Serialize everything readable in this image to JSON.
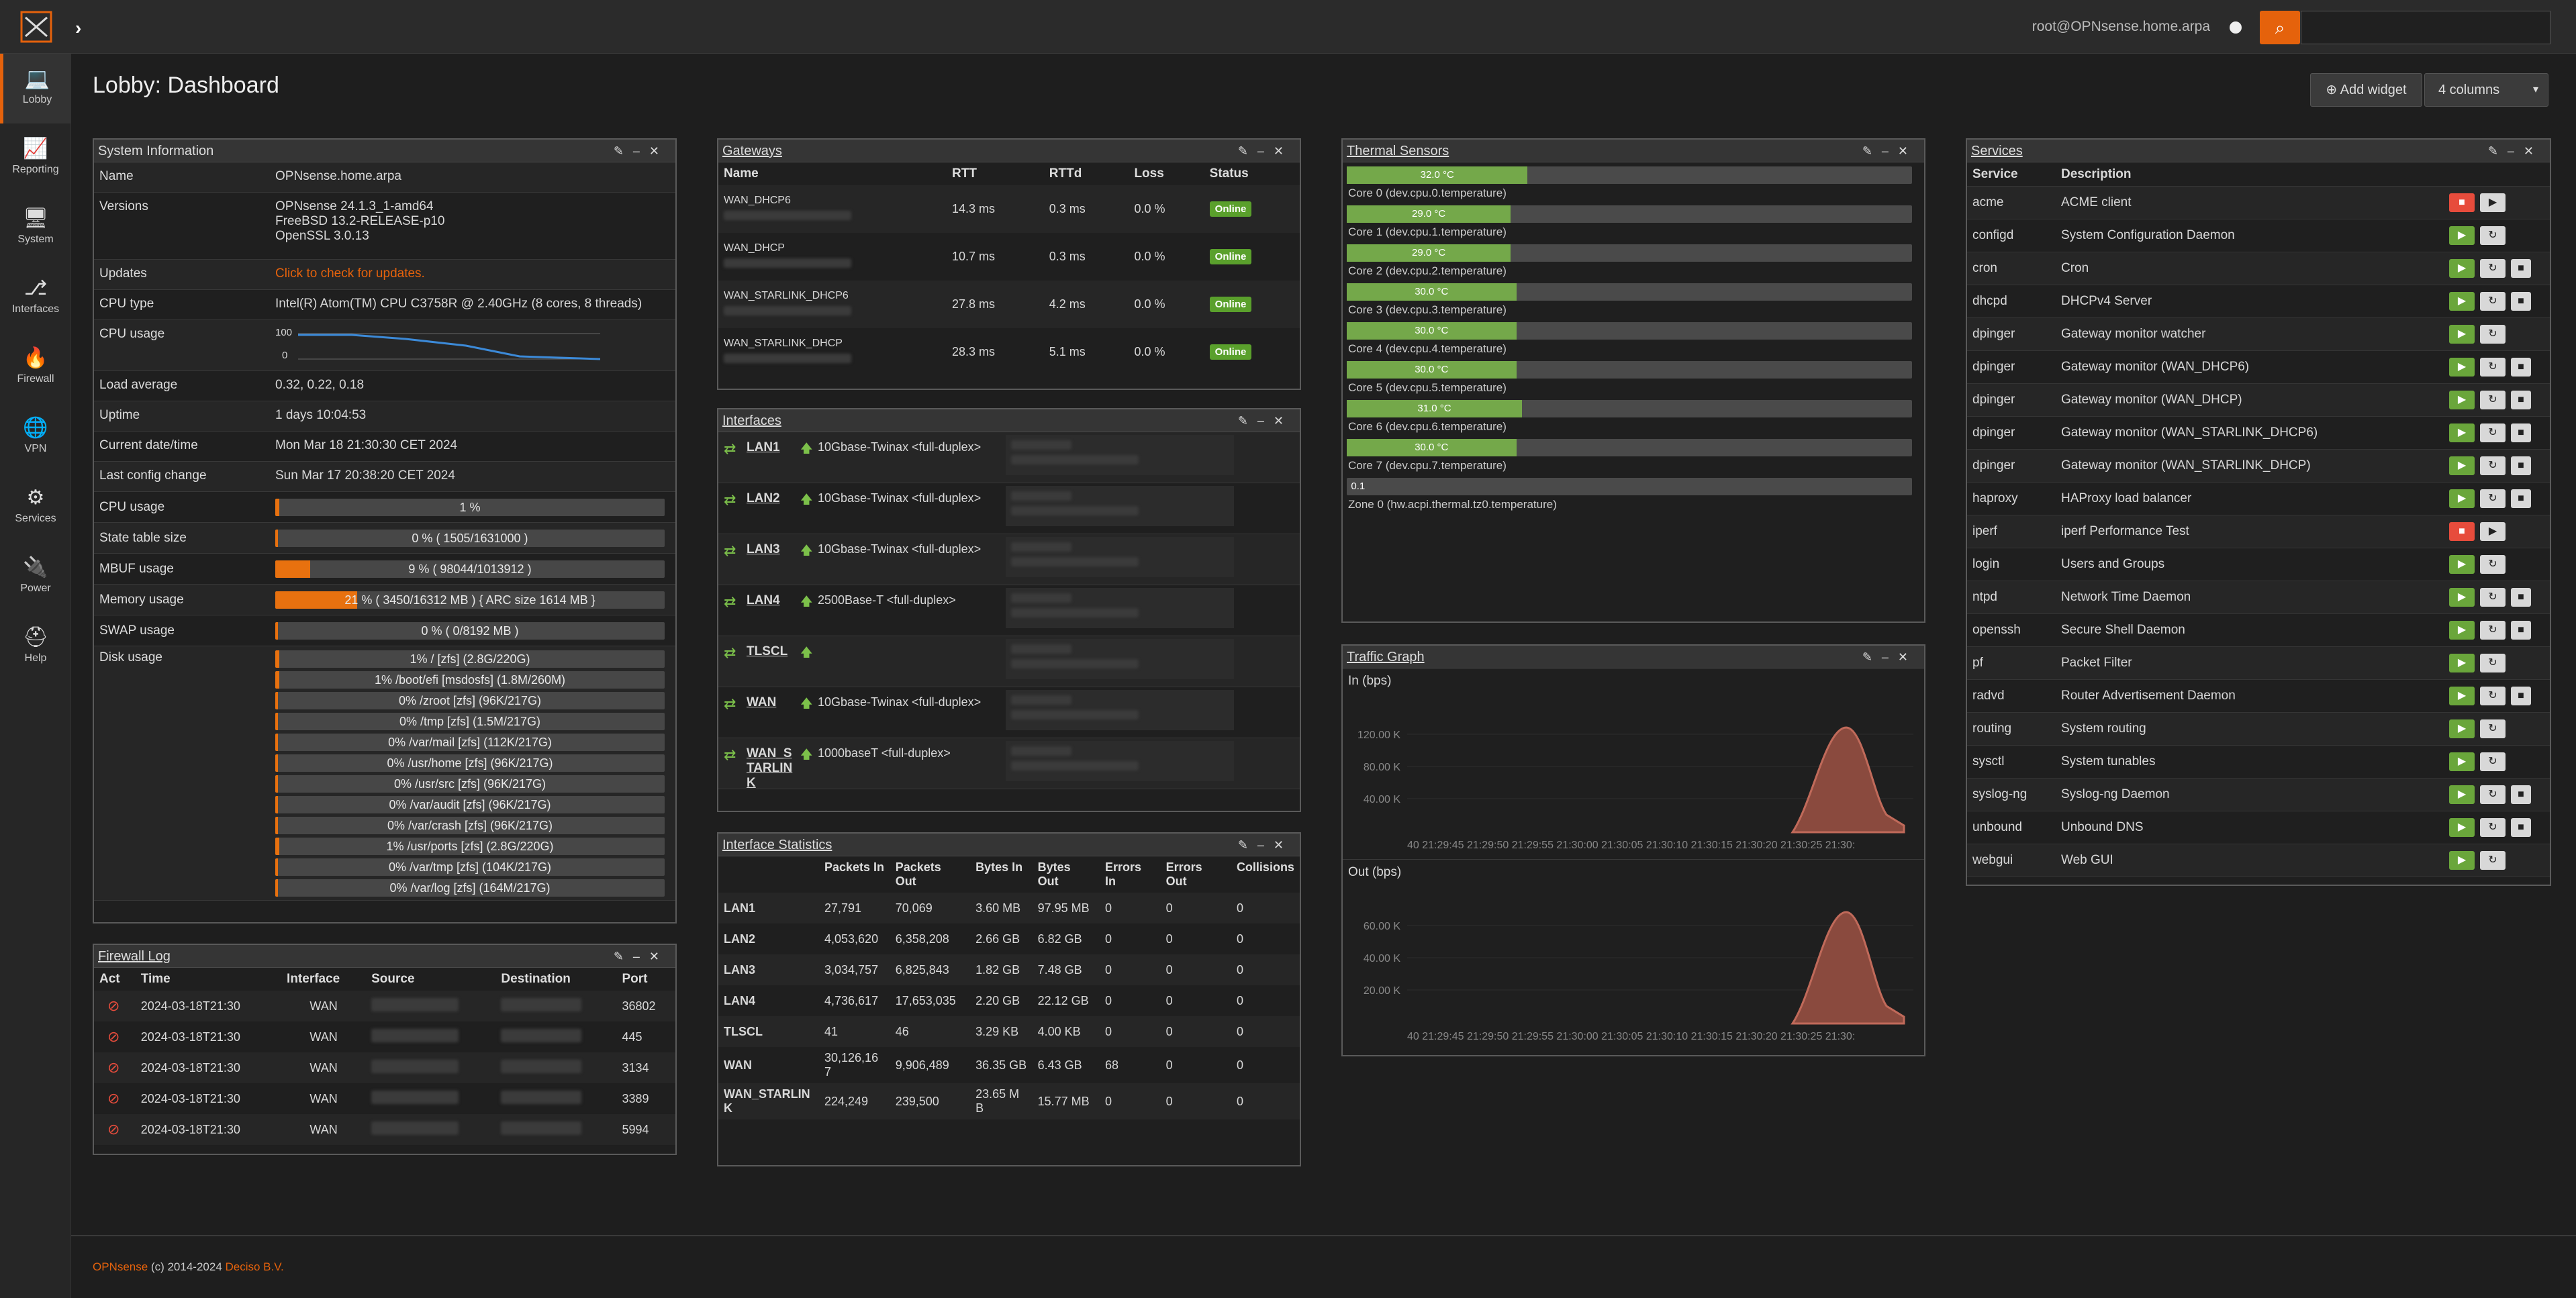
{
  "header": {
    "user": "root@OPNsense.home.arpa",
    "search_placeholder": ""
  },
  "sidebar": [
    {
      "label": "Lobby",
      "icon": "laptop-icon",
      "glyph": "💻"
    },
    {
      "label": "Reporting",
      "icon": "chart-icon",
      "glyph": "📈"
    },
    {
      "label": "System",
      "icon": "server-icon",
      "glyph": "🖥"
    },
    {
      "label": "Interfaces",
      "icon": "sitemap-icon",
      "glyph": "⎇"
    },
    {
      "label": "Firewall",
      "icon": "fire-icon",
      "glyph": "🔥"
    },
    {
      "label": "VPN",
      "icon": "globe-icon",
      "glyph": "🌐"
    },
    {
      "label": "Services",
      "icon": "cog-icon",
      "glyph": "⚙"
    },
    {
      "label": "Power",
      "icon": "plug-icon",
      "glyph": "🔌"
    },
    {
      "label": "Help",
      "icon": "lifebuoy-icon",
      "glyph": "⛑"
    }
  ],
  "page": {
    "title": "Lobby: Dashboard",
    "add_widget": "Add widget",
    "columns": "4 columns"
  },
  "sysinfo": {
    "title": "System Information",
    "name_label": "Name",
    "name": "OPNsense.home.arpa",
    "versions_label": "Versions",
    "versions": [
      "OPNsense 24.1.3_1-amd64",
      "FreeBSD 13.2-RELEASE-p10",
      "OpenSSL 3.0.13"
    ],
    "updates_label": "Updates",
    "updates": "Click to check for updates.",
    "cpu_type_label": "CPU type",
    "cpu_type": "Intel(R) Atom(TM) CPU C3758R @ 2.40GHz (8 cores, 8 threads)",
    "cpu_usage_label": "CPU usage",
    "cpu_graph_max": "100",
    "cpu_graph_min": "0",
    "load_label": "Load average",
    "load": "0.32, 0.22, 0.18",
    "uptime_label": "Uptime",
    "uptime": "1 days 10:04:53",
    "date_label": "Current date/time",
    "date": "Mon Mar 18 21:30:30 CET 2024",
    "lastconf_label": "Last config change",
    "lastconf": "Sun Mar 17 20:38:20 CET 2024",
    "bars": [
      {
        "label": "CPU usage",
        "text": "1 %",
        "pct": 1
      },
      {
        "label": "State table size",
        "text": "0 % ( 1505/1631000 )",
        "pct": 0
      },
      {
        "label": "MBUF usage",
        "text": "9 % ( 98044/1013912 )",
        "pct": 9
      },
      {
        "label": "Memory usage",
        "text": "21 % ( 3450/16312 MB ) { ARC size 1614 MB }",
        "pct": 21
      },
      {
        "label": "SWAP usage",
        "text": "0 % ( 0/8192 MB )",
        "pct": 0
      }
    ],
    "disk_label": "Disk usage",
    "disks": [
      {
        "text": "1% / [zfs] (2.8G/220G)",
        "pct": 1
      },
      {
        "text": "1% /boot/efi [msdosfs] (1.8M/260M)",
        "pct": 1
      },
      {
        "text": "0% /zroot [zfs] (96K/217G)",
        "pct": 0
      },
      {
        "text": "0% /tmp [zfs] (1.5M/217G)",
        "pct": 0
      },
      {
        "text": "0% /var/mail [zfs] (112K/217G)",
        "pct": 0
      },
      {
        "text": "0% /usr/home [zfs] (96K/217G)",
        "pct": 0
      },
      {
        "text": "0% /usr/src [zfs] (96K/217G)",
        "pct": 0
      },
      {
        "text": "0% /var/audit [zfs] (96K/217G)",
        "pct": 0
      },
      {
        "text": "0% /var/crash [zfs] (96K/217G)",
        "pct": 0
      },
      {
        "text": "1% /usr/ports [zfs] (2.8G/220G)",
        "pct": 1
      },
      {
        "text": "0% /var/tmp [zfs] (104K/217G)",
        "pct": 0
      },
      {
        "text": "0% /var/log [zfs] (164M/217G)",
        "pct": 0
      }
    ]
  },
  "firewall": {
    "title": "Firewall Log",
    "headers": [
      "Act",
      "Time",
      "Interface",
      "Source",
      "Destination",
      "Port"
    ],
    "rows": [
      {
        "time": "2024-03-18T21:30",
        "iface": "WAN",
        "port": "36802"
      },
      {
        "time": "2024-03-18T21:30",
        "iface": "WAN",
        "port": "445"
      },
      {
        "time": "2024-03-18T21:30",
        "iface": "WAN",
        "port": "3134"
      },
      {
        "time": "2024-03-18T21:30",
        "iface": "WAN",
        "port": "3389"
      },
      {
        "time": "2024-03-18T21:30",
        "iface": "WAN",
        "port": "5994"
      }
    ]
  },
  "gateways": {
    "title": "Gateways",
    "headers": [
      "Name",
      "RTT",
      "RTTd",
      "Loss",
      "Status"
    ],
    "rows": [
      {
        "name": "WAN_DHCP6",
        "rtt": "14.3 ms",
        "rttd": "0.3 ms",
        "loss": "0.0 %",
        "status": "Online"
      },
      {
        "name": "WAN_DHCP",
        "rtt": "10.7 ms",
        "rttd": "0.3 ms",
        "loss": "0.0 %",
        "status": "Online"
      },
      {
        "name": "WAN_STARLINK_DHCP6",
        "rtt": "27.8 ms",
        "rttd": "4.2 ms",
        "loss": "0.0 %",
        "status": "Online"
      },
      {
        "name": "WAN_STARLINK_DHCP",
        "rtt": "28.3 ms",
        "rttd": "5.1 ms",
        "loss": "0.0 %",
        "status": "Online"
      }
    ]
  },
  "interfaces": {
    "title": "Interfaces",
    "rows": [
      {
        "name": "LAN1",
        "media": "10Gbase-Twinax <full-duplex>"
      },
      {
        "name": "LAN2",
        "media": "10Gbase-Twinax <full-duplex>"
      },
      {
        "name": "LAN3",
        "media": "10Gbase-Twinax <full-duplex>"
      },
      {
        "name": "LAN4",
        "media": "2500Base-T <full-duplex>"
      },
      {
        "name": "TLSCL",
        "media": ""
      },
      {
        "name": "WAN",
        "media": "10Gbase-Twinax <full-duplex>"
      },
      {
        "name": "WAN_STARLINK",
        "media": "1000baseT <full-duplex>"
      }
    ]
  },
  "ifstats": {
    "title": "Interface Statistics",
    "headers": [
      "",
      "Packets In",
      "Packets Out",
      "Bytes In",
      "Bytes Out",
      "Errors In",
      "Errors Out",
      "Collisions"
    ],
    "rows": [
      [
        "LAN1",
        "27,791",
        "70,069",
        "3.60 MB",
        "97.95 MB",
        "0",
        "0",
        "0"
      ],
      [
        "LAN2",
        "4,053,620",
        "6,358,208",
        "2.66 GB",
        "6.82 GB",
        "0",
        "0",
        "0"
      ],
      [
        "LAN3",
        "3,034,757",
        "6,825,843",
        "1.82 GB",
        "7.48 GB",
        "0",
        "0",
        "0"
      ],
      [
        "LAN4",
        "4,736,617",
        "17,653,035",
        "2.20 GB",
        "22.12 GB",
        "0",
        "0",
        "0"
      ],
      [
        "TLSCL",
        "41",
        "46",
        "3.29 KB",
        "4.00 KB",
        "0",
        "0",
        "0"
      ],
      [
        "WAN",
        "30,126,167",
        "9,906,489",
        "36.35 GB",
        "6.43 GB",
        "68",
        "0",
        "0"
      ],
      [
        "WAN_STARLINK",
        "224,249",
        "239,500",
        "23.65 MB",
        "15.77 MB",
        "0",
        "0",
        "0"
      ]
    ]
  },
  "thermal": {
    "title": "Thermal Sensors",
    "sensors": [
      {
        "value": "32.0 °C",
        "pct": 32,
        "label": "Core 0 (dev.cpu.0.temperature)"
      },
      {
        "value": "29.0 °C",
        "pct": 29,
        "label": "Core 1 (dev.cpu.1.temperature)"
      },
      {
        "value": "29.0 °C",
        "pct": 29,
        "label": "Core 2 (dev.cpu.2.temperature)"
      },
      {
        "value": "30.0 °C",
        "pct": 30,
        "label": "Core 3 (dev.cpu.3.temperature)"
      },
      {
        "value": "30.0 °C",
        "pct": 30,
        "label": "Core 4 (dev.cpu.4.temperature)"
      },
      {
        "value": "30.0 °C",
        "pct": 30,
        "label": "Core 5 (dev.cpu.5.temperature)"
      },
      {
        "value": "31.0 °C",
        "pct": 31,
        "label": "Core 6 (dev.cpu.6.temperature)"
      },
      {
        "value": "30.0 °C",
        "pct": 30,
        "label": "Core 7 (dev.cpu.7.temperature)"
      },
      {
        "value": "0.1",
        "pct": 0,
        "label": "Zone 0 (hw.acpi.thermal.tz0.temperature)"
      }
    ]
  },
  "traffic": {
    "title": "Traffic Graph",
    "in_label": "In (bps)",
    "out_label": "Out (bps)",
    "in_ticks": [
      "120.00 K",
      "80.00 K",
      "40.00 K"
    ],
    "out_ticks": [
      "60.00 K",
      "40.00 K",
      "20.00 K"
    ],
    "xticks": "40 21:29:45 21:29:50 21:29:55 21:30:00 21:30:05 21:30:10 21:30:15 21:30:20 21:30:25 21:30:"
  },
  "services": {
    "title": "Services",
    "headers": [
      "Service",
      "Description"
    ],
    "rows": [
      {
        "name": "acme",
        "desc": "ACME client",
        "running": false,
        "restart": false
      },
      {
        "name": "configd",
        "desc": "System Configuration Daemon",
        "running": true,
        "restart": true
      },
      {
        "name": "cron",
        "desc": "Cron",
        "running": true,
        "restart": true,
        "stop": true
      },
      {
        "name": "dhcpd",
        "desc": "DHCPv4 Server",
        "running": true,
        "restart": true,
        "stop": true
      },
      {
        "name": "dpinger",
        "desc": "Gateway monitor watcher",
        "running": true,
        "restart": true
      },
      {
        "name": "dpinger",
        "desc": "Gateway monitor (WAN_DHCP6)",
        "running": true,
        "restart": true,
        "stop": true
      },
      {
        "name": "dpinger",
        "desc": "Gateway monitor (WAN_DHCP)",
        "running": true,
        "restart": true,
        "stop": true
      },
      {
        "name": "dpinger",
        "desc": "Gateway monitor (WAN_STARLINK_DHCP6)",
        "running": true,
        "restart": true,
        "stop": true
      },
      {
        "name": "dpinger",
        "desc": "Gateway monitor (WAN_STARLINK_DHCP)",
        "running": true,
        "restart": true,
        "stop": true
      },
      {
        "name": "haproxy",
        "desc": "HAProxy load balancer",
        "running": true,
        "restart": true,
        "stop": true
      },
      {
        "name": "iperf",
        "desc": "iperf Performance Test",
        "running": false,
        "restart": false
      },
      {
        "name": "login",
        "desc": "Users and Groups",
        "running": true,
        "restart": true
      },
      {
        "name": "ntpd",
        "desc": "Network Time Daemon",
        "running": true,
        "restart": true,
        "stop": true
      },
      {
        "name": "openssh",
        "desc": "Secure Shell Daemon",
        "running": true,
        "restart": true,
        "stop": true
      },
      {
        "name": "pf",
        "desc": "Packet Filter",
        "running": true,
        "restart": true
      },
      {
        "name": "radvd",
        "desc": "Router Advertisement Daemon",
        "running": true,
        "restart": true,
        "stop": true
      },
      {
        "name": "routing",
        "desc": "System routing",
        "running": true,
        "restart": true
      },
      {
        "name": "sysctl",
        "desc": "System tunables",
        "running": true,
        "restart": true
      },
      {
        "name": "syslog-ng",
        "desc": "Syslog-ng Daemon",
        "running": true,
        "restart": true,
        "stop": true
      },
      {
        "name": "unbound",
        "desc": "Unbound DNS",
        "running": true,
        "restart": true,
        "stop": true
      },
      {
        "name": "webgui",
        "desc": "Web GUI",
        "running": true,
        "restart": true
      }
    ]
  },
  "footer": {
    "brand": "OPNsense",
    "copy": " (c) 2014-2024 ",
    "company": "Deciso B.V."
  },
  "colors": {
    "accent": "#e5620c",
    "online": "#5aa02c",
    "thermal": "#74a84a",
    "traffic": "#8a4a3e"
  }
}
